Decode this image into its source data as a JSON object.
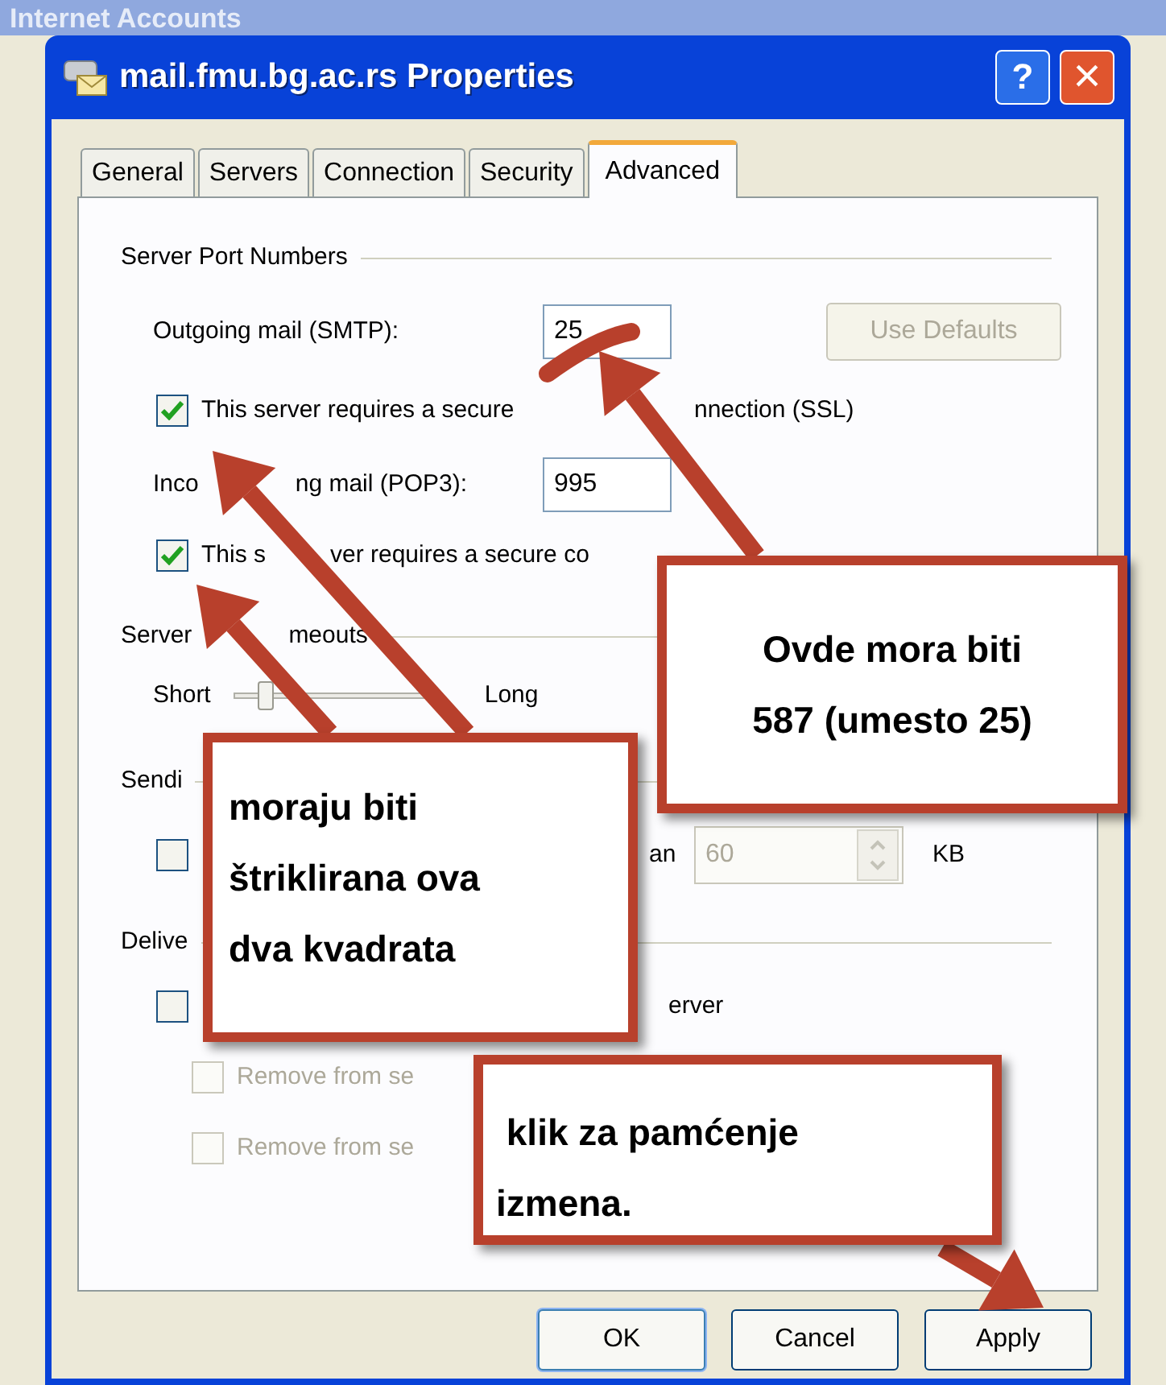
{
  "background_window": {
    "title": "Internet Accounts"
  },
  "window": {
    "title": "mail.fmu.bg.ac.rs Properties",
    "help": "?",
    "close": "×"
  },
  "tabs": [
    {
      "label": "General",
      "selected": false
    },
    {
      "label": "Servers",
      "selected": false
    },
    {
      "label": "Connection",
      "selected": false
    },
    {
      "label": "Security",
      "selected": false
    },
    {
      "label": "Advanced",
      "selected": true
    }
  ],
  "server_port_numbers": {
    "heading": "Server Port Numbers",
    "outgoing": {
      "label": "Outgoing mail (SMTP):",
      "value": "25"
    },
    "use_defaults": {
      "label": "Use Defaults",
      "disabled": true
    },
    "outgoing_ssl": {
      "label_parts": [
        "This server requires a secure",
        "nnection (SSL)"
      ],
      "checked": true
    },
    "incoming": {
      "label_parts": [
        "Inco",
        "ng mail (POP3):"
      ],
      "value": "995"
    },
    "incoming_ssl": {
      "label_parts": [
        "This s",
        "ver requires a secure co"
      ],
      "checked": true
    }
  },
  "server_timeouts": {
    "heading_parts": [
      "Server",
      "meouts"
    ],
    "min_label": "Short",
    "max_label": "Long",
    "level": 0.12
  },
  "sending": {
    "heading": "Sendi",
    "split": {
      "label": "an",
      "checked": false,
      "value": "60",
      "unit": "KB",
      "disabled": true
    }
  },
  "delivery": {
    "heading": "Delive",
    "leave_copy": {
      "label": "erver",
      "checked": false
    },
    "remove_rows": [
      {
        "label": "Remove from se",
        "checked": false,
        "disabled": true
      },
      {
        "label": "Remove from se",
        "checked": false,
        "disabled": true
      }
    ]
  },
  "buttons": [
    {
      "label": "OK",
      "default": true
    },
    {
      "label": "Cancel",
      "default": false
    },
    {
      "label": "Apply",
      "default": false
    }
  ],
  "callouts": [
    {
      "text": "Ovde mora biti\n587 (umesto 25)"
    },
    {
      "text": "moraju biti\nštriklirana ova\ndva kvadrata"
    },
    {
      "text": " klik za pamćenje\nizmena."
    }
  ]
}
